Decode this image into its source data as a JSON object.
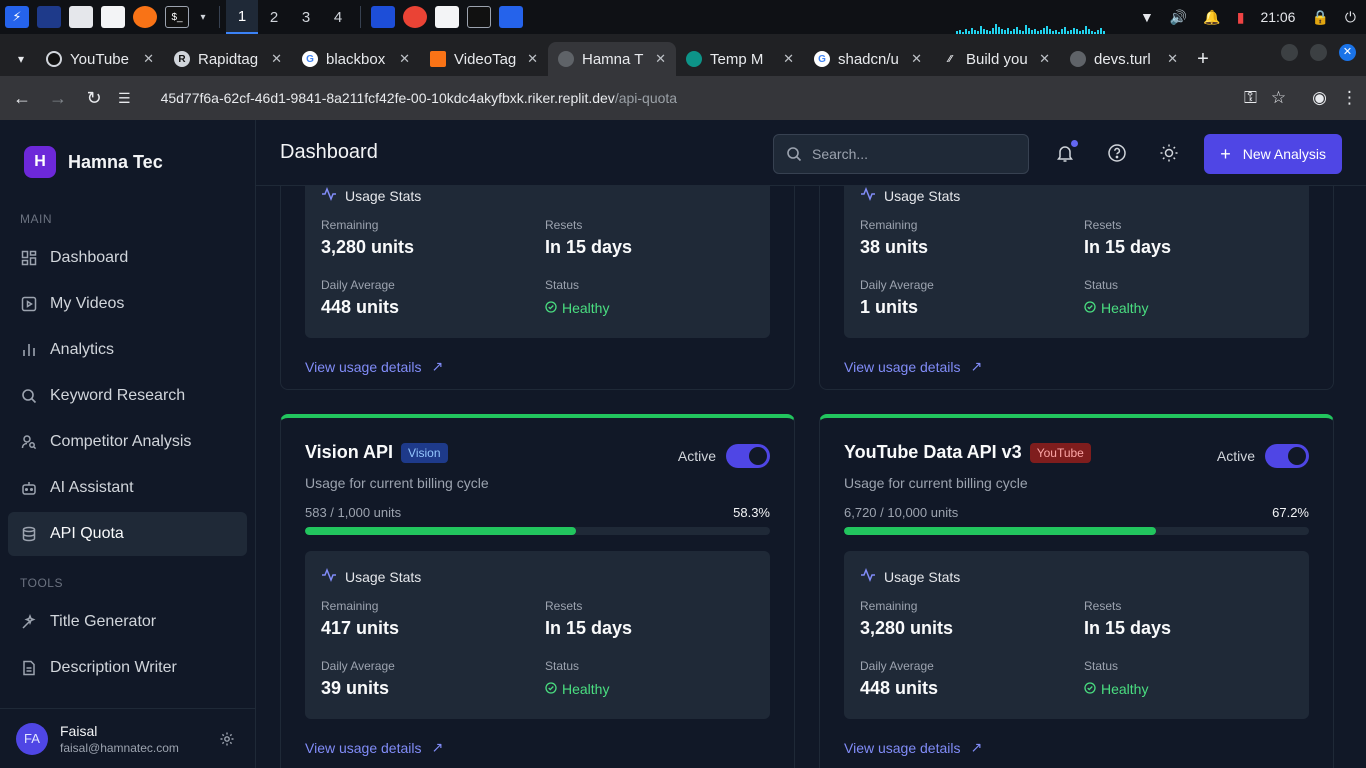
{
  "os": {
    "workspaces": [
      "1",
      "2",
      "3",
      "4"
    ],
    "clock": "21:06"
  },
  "browser": {
    "tabs": [
      {
        "title": "YouTube"
      },
      {
        "title": "Rapidtag"
      },
      {
        "title": "blackbox"
      },
      {
        "title": "VideoTag"
      },
      {
        "title": "Hamna T"
      },
      {
        "title": "Temp M"
      },
      {
        "title": "shadcn/u"
      },
      {
        "title": "Build you"
      },
      {
        "title": "devs.turl"
      }
    ],
    "url_host": "45d77f6a-62cf-46d1-9841-8a211fcf42fe-00-10kdc4akyfbxk.riker.replit.dev",
    "url_path": "/api-quota"
  },
  "sidebar": {
    "brand_initial": "H",
    "brand_name": "Hamna Tec",
    "main_label": "MAIN",
    "tools_label": "TOOLS",
    "main_items": [
      {
        "label": "Dashboard"
      },
      {
        "label": "My Videos"
      },
      {
        "label": "Analytics"
      },
      {
        "label": "Keyword Research"
      },
      {
        "label": "Competitor Analysis"
      },
      {
        "label": "AI Assistant"
      },
      {
        "label": "API Quota"
      }
    ],
    "tool_items": [
      {
        "label": "Title Generator"
      },
      {
        "label": "Description Writer"
      }
    ],
    "user": {
      "initials": "FA",
      "name": "Faisal",
      "email": "faisal@hamnatec.com"
    }
  },
  "header": {
    "title": "Dashboard",
    "search_placeholder": "Search...",
    "new_button": "New Analysis"
  },
  "cards": [
    {
      "stats_title": "Usage Stats",
      "remaining_label": "Remaining",
      "remaining": "3,280 units",
      "resets_label": "Resets",
      "resets": "In 15 days",
      "daily_label": "Daily Average",
      "daily": "448 units",
      "status_label": "Status",
      "status": "Healthy",
      "link": "View usage details"
    },
    {
      "stats_title": "Usage Stats",
      "remaining_label": "Remaining",
      "remaining": "38 units",
      "resets_label": "Resets",
      "resets": "In 15 days",
      "daily_label": "Daily Average",
      "daily": "1 units",
      "status_label": "Status",
      "status": "Healthy",
      "link": "View usage details"
    },
    {
      "name": "Vision API",
      "badge": "Vision",
      "active_label": "Active",
      "subtitle": "Usage for current billing cycle",
      "usage": "583 / 1,000 units",
      "percent": "58.3%",
      "fraction": 0.583,
      "stats_title": "Usage Stats",
      "remaining_label": "Remaining",
      "remaining": "417 units",
      "resets_label": "Resets",
      "resets": "In 15 days",
      "daily_label": "Daily Average",
      "daily": "39 units",
      "status_label": "Status",
      "status": "Healthy",
      "link": "View usage details"
    },
    {
      "name": "YouTube Data API v3",
      "badge": "YouTube",
      "active_label": "Active",
      "subtitle": "Usage for current billing cycle",
      "usage": "6,720 / 10,000 units",
      "percent": "67.2%",
      "fraction": 0.672,
      "stats_title": "Usage Stats",
      "remaining_label": "Remaining",
      "remaining": "3,280 units",
      "resets_label": "Resets",
      "resets": "In 15 days",
      "daily_label": "Daily Average",
      "daily": "448 units",
      "status_label": "Status",
      "status": "Healthy",
      "link": "View usage details"
    }
  ],
  "colors": {
    "accent": "#4f46e5",
    "healthy": "#22c55e",
    "link": "#818cf8"
  }
}
